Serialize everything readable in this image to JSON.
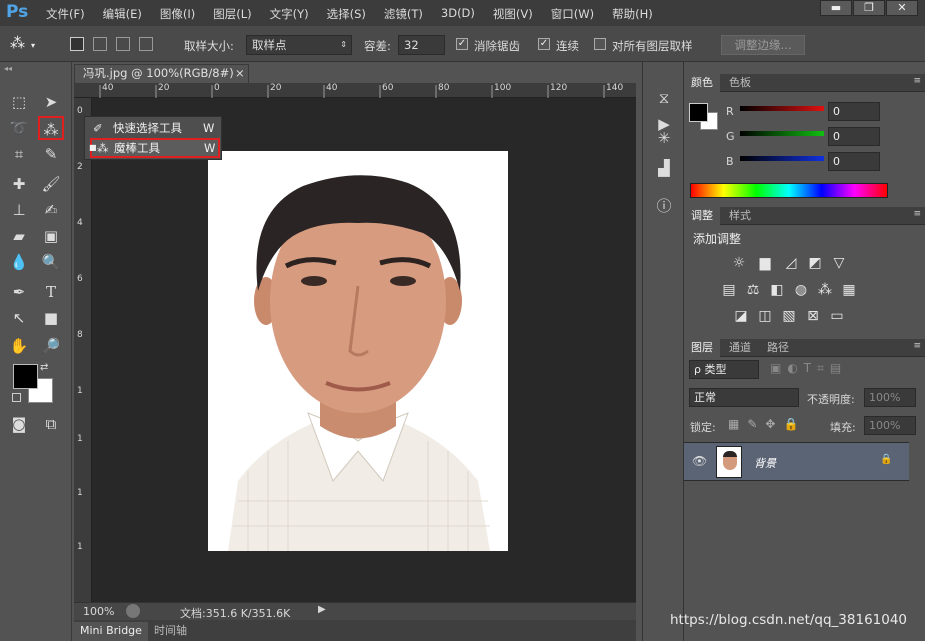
{
  "app": {
    "logo": "Ps"
  },
  "menu": [
    "文件(F)",
    "编辑(E)",
    "图像(I)",
    "图层(L)",
    "文字(Y)",
    "选择(S)",
    "滤镜(T)",
    "3D(D)",
    "视图(V)",
    "窗口(W)",
    "帮助(H)"
  ],
  "window_controls": {
    "minimize": "▬",
    "restore": "❐",
    "close": "✕"
  },
  "options": {
    "sample_size_label": "取样大小:",
    "sample_size_value": "取样点",
    "tolerance_label": "容差:",
    "tolerance_value": "32",
    "antialias_label": "消除锯齿",
    "antialias_checked": true,
    "contiguous_label": "连续",
    "contiguous_checked": true,
    "sample_all_label": "对所有图层取样",
    "sample_all_checked": false,
    "refine_edge_label": "调整边缘..."
  },
  "flyout": {
    "items": [
      {
        "label": "快速选择工具",
        "shortcut": "W",
        "selected": false
      },
      {
        "label": "魔棒工具",
        "shortcut": "W",
        "selected": true
      }
    ]
  },
  "document": {
    "tab_title": "冯巩.jpg @ 100%(RGB/8#)",
    "close": "×",
    "ruler_top": [
      "40",
      "20",
      "0",
      "20",
      "40",
      "60",
      "80",
      "100",
      "120",
      "140"
    ],
    "ruler_left": [
      "0",
      "2",
      "4",
      "6",
      "8",
      "1",
      "1",
      "1",
      "1",
      "1",
      "1",
      "1",
      "1"
    ]
  },
  "status": {
    "zoom": "100%",
    "doc_info": "文档:351.6 K/351.6K"
  },
  "bottom_tabs": [
    "Mini Bridge",
    "时间轴"
  ],
  "color_panel": {
    "tabs": [
      "颜色",
      "色板"
    ],
    "channels": [
      {
        "name": "R",
        "value": "0"
      },
      {
        "name": "G",
        "value": "0"
      },
      {
        "name": "B",
        "value": "0"
      }
    ],
    "colors": {
      "r": "#e01010",
      "g": "#10c010",
      "b": "#1030e0",
      "fg": "#000000",
      "bg": "#ffffff"
    }
  },
  "adjust_panel": {
    "tabs": [
      "调整",
      "样式"
    ],
    "title": "添加调整"
  },
  "layers_panel": {
    "tabs": [
      "图层",
      "通道",
      "路径"
    ],
    "kind_label": "ρ 类型",
    "blend_mode": "正常",
    "opacity_label": "不透明度:",
    "opacity_value": "100%",
    "lock_label": "锁定:",
    "fill_label": "填充:",
    "fill_value": "100%",
    "layer_name": "背景"
  },
  "watermark": "https://blog.csdn.net/qq_38161040"
}
